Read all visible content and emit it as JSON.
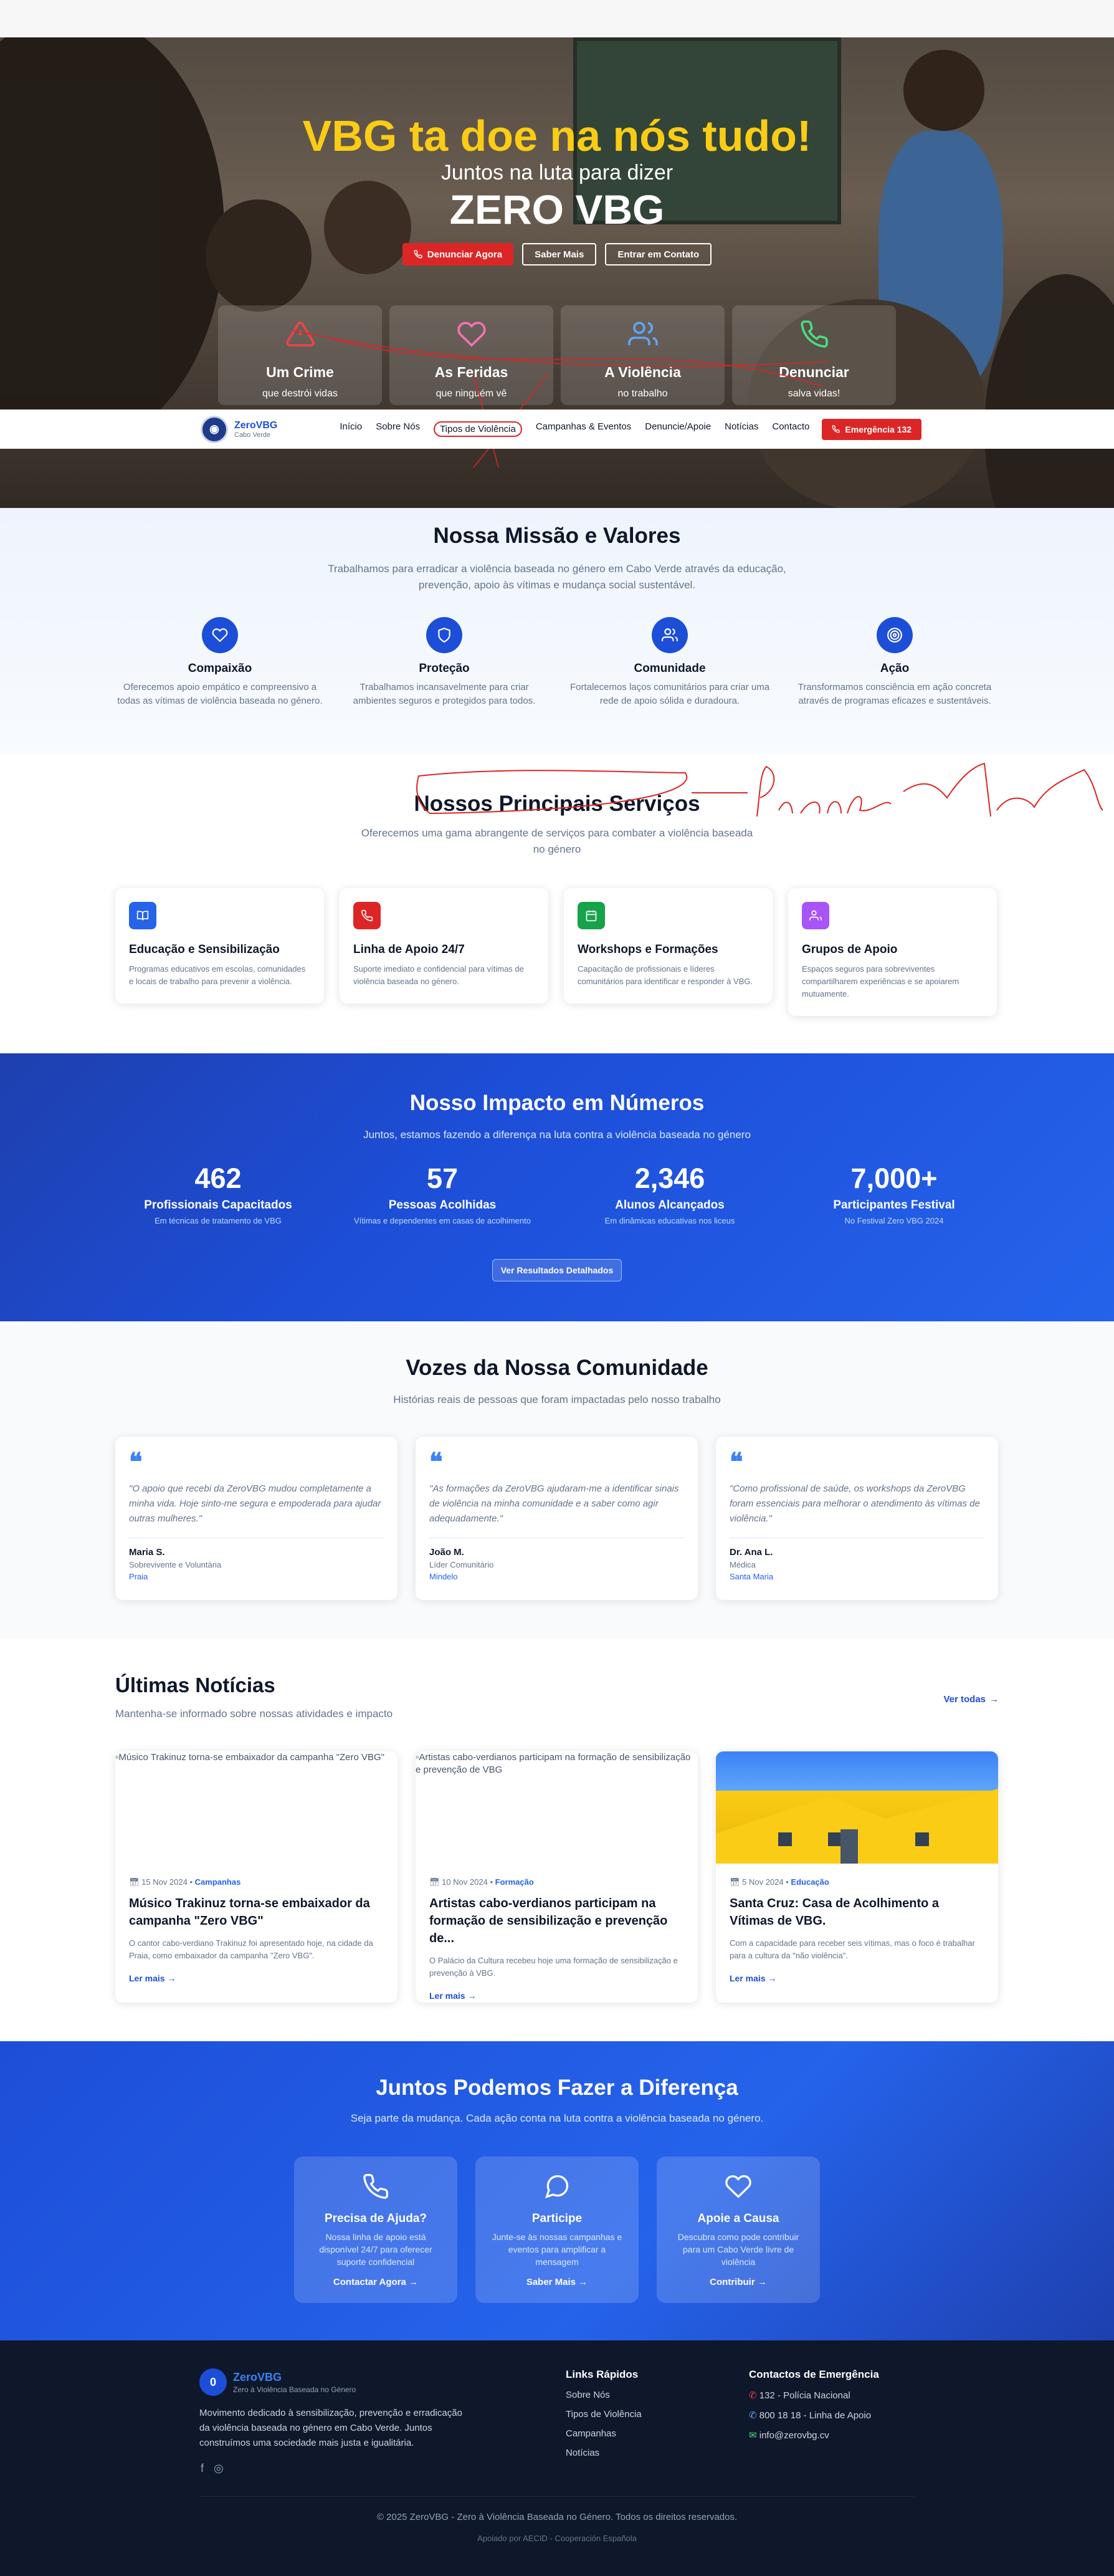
{
  "hero": {
    "title": "VBG ta doe na nós tudo!",
    "subtitle": "Juntos na luta para dizer",
    "big": "ZERO VBG",
    "btn_report": "Denunciar Agora",
    "btn_more": "Saber Mais",
    "btn_contact": "Entrar em Contato",
    "facts": [
      {
        "title": "Um Crime",
        "sub": "que destrói vidas"
      },
      {
        "title": "As Feridas",
        "sub": "que ninguém vê"
      },
      {
        "title": "A Violência",
        "sub": "no trabalho"
      },
      {
        "title": "Denunciar",
        "sub": "salva vidas!"
      }
    ]
  },
  "nav": {
    "logo_title": "ZeroVBG",
    "logo_sub": "Cabo Verde",
    "items": [
      "Início",
      "Sobre Nós",
      "Tipos de Violência",
      "Campanhas & Eventos",
      "Denuncie/Apoie",
      "Notícias",
      "Contacto"
    ],
    "emergency": "Emergência 132"
  },
  "mission": {
    "title": "Nossa Missão e Valores",
    "lead": "Trabalhamos para erradicar a violência baseada no género em Cabo Verde através da educação, prevenção, apoio às vítimas e mudança social sustentável.",
    "values": [
      {
        "title": "Compaixão",
        "desc": "Oferecemos apoio empático e compreensivo a todas as vítimas de violência baseada no género."
      },
      {
        "title": "Proteção",
        "desc": "Trabalhamos incansavelmente para criar ambientes seguros e protegidos para todos."
      },
      {
        "title": "Comunidade",
        "desc": "Fortalecemos laços comunitários para criar uma rede de apoio sólida e duradoura."
      },
      {
        "title": "Ação",
        "desc": "Transformamos consciência em ação concreta através de programas eficazes e sustentáveis."
      }
    ]
  },
  "services": {
    "title": "Nossos Principais Serviços",
    "lead": "Oferecemos uma gama abrangente de serviços para combater a violência baseada no género",
    "items": [
      {
        "title": "Educação e Sensibilização",
        "desc": "Programas educativos em escolas, comunidades e locais de trabalho para prevenir a violência.",
        "color": "#2563eb"
      },
      {
        "title": "Linha de Apoio 24/7",
        "desc": "Suporte imediato e confidencial para vítimas de violência baseada no género.",
        "color": "#dc2626"
      },
      {
        "title": "Workshops e Formações",
        "desc": "Capacitação de profissionais e líderes comunitários para identificar e responder à VBG.",
        "color": "#16a34a"
      },
      {
        "title": "Grupos de Apoio",
        "desc": "Espaços seguros para sobreviventes compartilharem experiências e se apoiarem mutuamente.",
        "color": "#a855f7"
      }
    ]
  },
  "impact": {
    "title": "Nosso Impacto em Números",
    "lead": "Juntos, estamos fazendo a diferença na luta contra a violência baseada no género",
    "stats": [
      {
        "number": "462",
        "label": "Profissionais Capacitados",
        "sub": "Em técnicas de tratamento de VBG"
      },
      {
        "number": "57",
        "label": "Pessoas Acolhidas",
        "sub": "Vítimas e dependentes em casas de acolhimento"
      },
      {
        "number": "2,346",
        "label": "Alunos Alcançados",
        "sub": "Em dinâmicas educativas nos liceus"
      },
      {
        "number": "7,000+",
        "label": "Participantes Festival",
        "sub": "No Festival Zero VBG 2024"
      }
    ],
    "button": "Ver Resultados Detalhados"
  },
  "voices": {
    "title": "Vozes da Nossa Comunidade",
    "lead": "Histórias reais de pessoas que foram impactadas pelo nosso trabalho",
    "quotes": [
      {
        "text": "\"O apoio que recebi da ZeroVBG mudou completamente a minha vida. Hoje sinto-me segura e empoderada para ajudar outras mulheres.\"",
        "name": "Maria S.",
        "role": "Sobrevivente e Voluntária",
        "place": "Praia"
      },
      {
        "text": "\"As formações da ZeroVBG ajudaram-me a identificar sinais de violência na minha comunidade e a saber como agir adequadamente.\"",
        "name": "João M.",
        "role": "Líder Comunitário",
        "place": "Mindelo"
      },
      {
        "text": "\"Como profissional de saúde, os workshops da ZeroVBG foram essenciais para melhorar o atendimento às vítimas de violência.\"",
        "name": "Dr. Ana L.",
        "role": "Médica",
        "place": "Santa Maria"
      }
    ]
  },
  "news": {
    "title": "Últimas Notícias",
    "lead": "Mantenha-se informado sobre nossas atividades e impacto",
    "see_all": "Ver todas",
    "read_more": "Ler mais →",
    "items": [
      {
        "alt": "Músico Trakinuz torna-se embaixador da campanha \"Zero VBG\"",
        "date": "15 Nov 2024",
        "cat": "Campanhas",
        "title": "Músico Trakinuz torna-se embaixador da campanha \"Zero VBG\"",
        "desc": "O cantor cabo-verdiano Trakinuz foi apresentado hoje, na cidade da Praia, como embaixador da campanha \"Zero VBG\"."
      },
      {
        "alt": "Artistas cabo-verdianos participam na formação de sensibilização e prevenção de VBG",
        "date": "10 Nov 2024",
        "cat": "Formação",
        "title": "Artistas cabo-verdianos participam na formação de sensibilização e prevenção de...",
        "desc": "O Palácio da Cultura recebeu hoje uma formação de sensibilização e prevenção à VBG."
      },
      {
        "alt": "",
        "date": "5 Nov 2024",
        "cat": "Educação",
        "title": "Santa Cruz: Casa de Acolhimento a Vítimas de VBG.",
        "desc": "Com a capacidade para receber seis vítimas, mas o foco é trabalhar para a cultura da \"não violência\"."
      }
    ]
  },
  "cta": {
    "title": "Juntos Podemos Fazer a Diferença",
    "lead": "Seja parte da mudança. Cada ação conta na luta contra a violência baseada no género.",
    "boxes": [
      {
        "title": "Precisa de Ajuda?",
        "desc": "Nossa linha de apoio está disponível 24/7 para oferecer suporte confidencial",
        "link": "Contactar Agora →"
      },
      {
        "title": "Participe",
        "desc": "Junte-se às nossas campanhas e eventos para amplificar a mensagem",
        "link": "Saber Mais →"
      },
      {
        "title": "Apoie a Causa",
        "desc": "Descubra como pode contribuir para um Cabo Verde livre de violência",
        "link": "Contribuir →"
      }
    ]
  },
  "footer": {
    "logo_letter": "0",
    "logo_title": "ZeroVBG",
    "logo_sub": "Zero à Violência Baseada no Género",
    "about": "Movimento dedicado à sensibilização, prevenção e erradicação da violência baseada no género em Cabo Verde. Juntos construímos uma sociedade mais justa e igualitária.",
    "links_title": "Links Rápidos",
    "links": [
      "Sobre Nós",
      "Tipos de Violência",
      "Campanhas",
      "Notícias"
    ],
    "contacts_title": "Contactos de Emergência",
    "contacts": [
      "132 - Polícia Nacional",
      "800 18 18 - Linha de Apoio",
      "info@zerovbg.cv"
    ],
    "copyright": "© 2025 ZeroVBG - Zero à Violência Baseada no Género. Todos os direitos reservados.",
    "support": "Apoiado por AECID - Cooperación Española"
  },
  "annotation": {
    "handwritten": "Principais Actividades"
  },
  "colors": {
    "primary": "#1d4ed8",
    "danger": "#dc2626",
    "accent": "#facc15"
  }
}
